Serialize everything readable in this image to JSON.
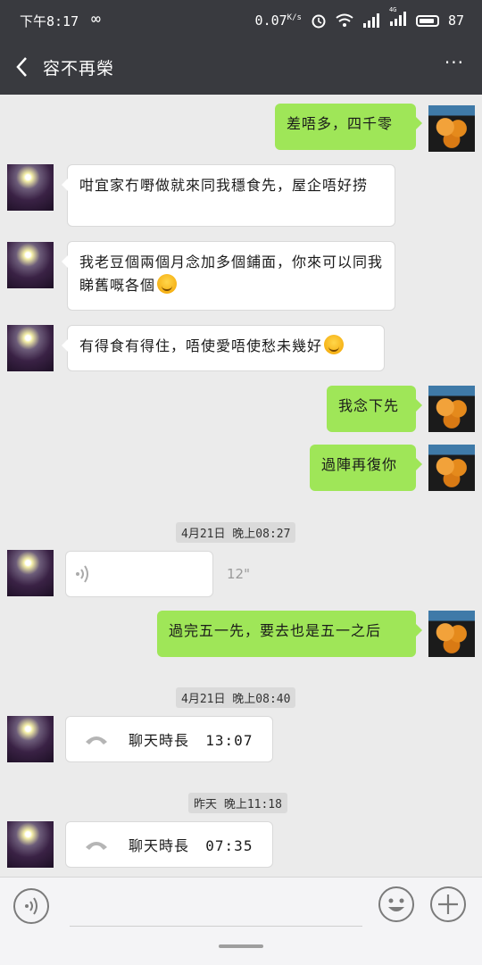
{
  "status": {
    "time": "下午8:17",
    "speed": "0.07",
    "speed_unit": "K/s",
    "battery": "87",
    "network_label": "4G"
  },
  "header": {
    "title": "容不再榮",
    "back_icon": "chevron-left-icon",
    "more_label": "···"
  },
  "messages": [
    {
      "side": "right",
      "text": "差唔多，四千零"
    },
    {
      "side": "left",
      "text": "咁宜家冇嘢做就來同我穩食先，屋企唔好捞"
    },
    {
      "side": "left",
      "text": "我老豆個兩個月念加多個鋪面，你來可以同我睇舊嘅各個",
      "emoji": "laughing-emoji-icon"
    },
    {
      "side": "left",
      "text": "有得食有得住，唔使愛唔使愁未幾好",
      "emoji": "smiling-emoji-icon"
    },
    {
      "side": "right",
      "text": "我念下先"
    },
    {
      "side": "right",
      "text": "過陣再復你"
    }
  ],
  "timestamp1": "4月21日  晚上08:27",
  "voice": {
    "duration": "12\""
  },
  "message7": "過完五一先，要去也是五一之后",
  "timestamp2": "4月21日  晚上08:40",
  "call1": {
    "label": "聊天時長",
    "duration": "13:07"
  },
  "timestamp3": "昨天  晚上11:18",
  "call2": {
    "label": "聊天時長",
    "duration": "07:35"
  },
  "colors": {
    "header_bg": "#393a3f",
    "bubble_green": "#9fe658",
    "chat_bg": "#ebebeb"
  }
}
